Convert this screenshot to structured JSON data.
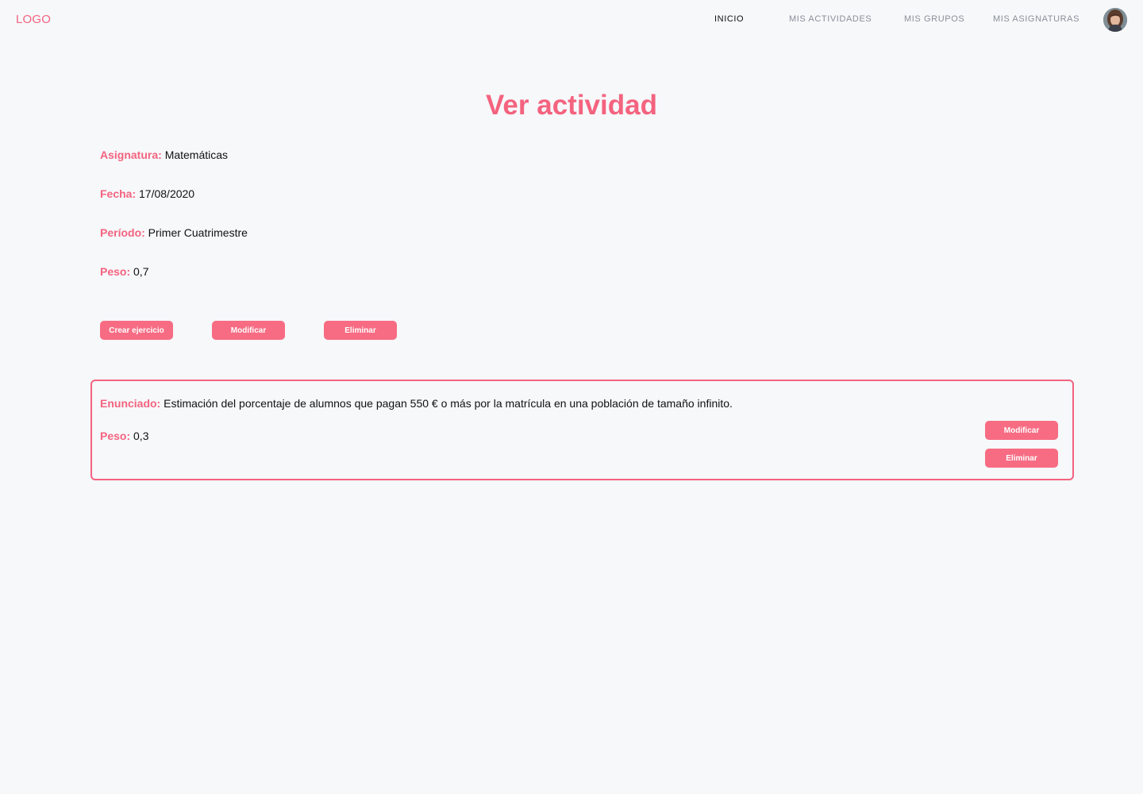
{
  "header": {
    "logo": "LOGO",
    "nav": [
      {
        "label": "INICIO",
        "active": true
      },
      {
        "label": "MIS ACTIVIDADES",
        "active": false
      },
      {
        "label": "MIS GRUPOS",
        "active": false
      },
      {
        "label": "MIS ASIGNATURAS",
        "active": false
      }
    ],
    "avatar_icon": "user-avatar-icon"
  },
  "main": {
    "title": "Ver actividad",
    "fields": [
      {
        "label": "Asignatura:",
        "value": "Matemáticas"
      },
      {
        "label": "Fecha:",
        "value": "17/08/2020"
      },
      {
        "label": "Período:",
        "value": "Primer Cuatrimestre"
      },
      {
        "label": "Peso:",
        "value": "0,7"
      }
    ],
    "actions": {
      "create_label": "Crear ejercicio",
      "modify_label": "Modificar",
      "delete_label": "Eliminar"
    },
    "exercises": [
      {
        "statement_label": "Enunciado:",
        "statement": "Estimación del porcentaje de alumnos que pagan 550 € o más por la matrícula en una población de tamaño infinito.",
        "weight_label": "Peso:",
        "weight": "0,3",
        "modify_label": "Modificar",
        "delete_label": "Eliminar"
      }
    ]
  },
  "colors": {
    "accent": "#f4637f",
    "button": "#f76c83",
    "background": "#f6f8fa",
    "text": "#111111",
    "nav_inactive": "#8a8f99"
  }
}
